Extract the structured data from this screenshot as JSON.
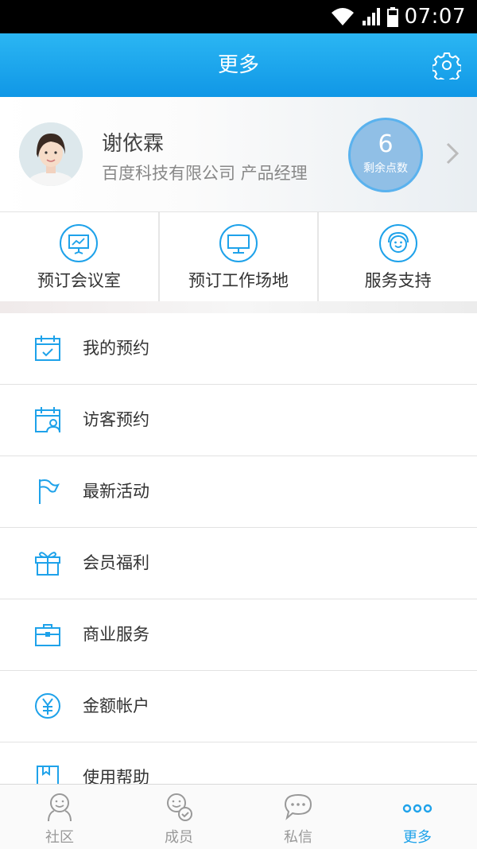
{
  "status_bar": {
    "time": "07:07"
  },
  "header": {
    "title": "更多"
  },
  "profile": {
    "name": "谢依霖",
    "company_role": "百度科技有限公司   产品经理",
    "points_value": "6",
    "points_label": "剩余点数"
  },
  "quick_actions": [
    {
      "label": "预订会议室",
      "icon": "presentation-board-icon"
    },
    {
      "label": "预订工作场地",
      "icon": "monitor-icon"
    },
    {
      "label": "服务支持",
      "icon": "smiley-support-icon"
    }
  ],
  "menu": [
    {
      "label": "我的预约",
      "icon": "calendar-check-icon"
    },
    {
      "label": "访客预约",
      "icon": "calendar-visitor-icon"
    },
    {
      "label": "最新活动",
      "icon": "flag-icon"
    },
    {
      "label": "会员福利",
      "icon": "gift-icon"
    },
    {
      "label": "商业服务",
      "icon": "briefcase-icon"
    },
    {
      "label": "金额帐户",
      "icon": "yuan-coin-icon"
    },
    {
      "label": "使用帮助",
      "icon": "help-book-icon"
    }
  ],
  "tabs": [
    {
      "label": "社区",
      "icon": "community-icon",
      "active": false
    },
    {
      "label": "成员",
      "icon": "members-icon",
      "active": false
    },
    {
      "label": "私信",
      "icon": "message-bubble-icon",
      "active": false
    },
    {
      "label": "更多",
      "icon": "more-dots-icon",
      "active": true
    }
  ],
  "colors": {
    "accent": "#1ea2ea",
    "header_top": "#2bb6f3",
    "header_bottom": "#1097e6"
  }
}
